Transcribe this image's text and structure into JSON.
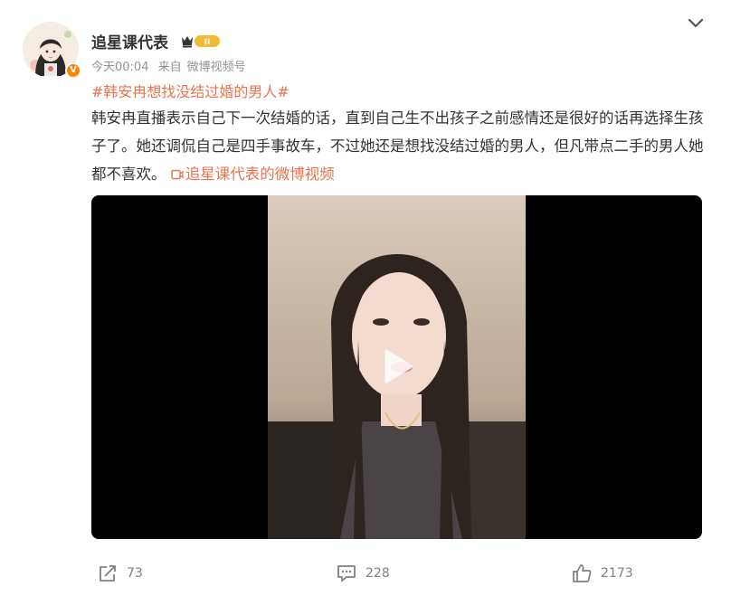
{
  "post": {
    "author": "追星课代表",
    "timestamp": "今天00:04",
    "source_prefix": "来自",
    "source": "微博视频号",
    "vip_level": "II",
    "verified_mark": "V",
    "hashtag": "#韩安冉想找没结过婚的男人#",
    "text": "韩安冉直播表示自己下一次结婚的话，直到自己生不出孩子之前感情还是很好的话再选择生孩子了。她还调侃自己是四手事故车，不过她还是想找没结过婚的男人，但凡带点二手的男人她都不喜欢。",
    "video_link": "追星课代表的微博视频",
    "accent_color": "#eb7350"
  },
  "actions": {
    "repost_count": "73",
    "comment_count": "228",
    "like_count": "2173"
  },
  "icons": [
    "chevron-down-icon",
    "vip-crown-icon",
    "video-link-icon",
    "play-icon",
    "repost-icon",
    "comment-icon",
    "like-icon"
  ]
}
